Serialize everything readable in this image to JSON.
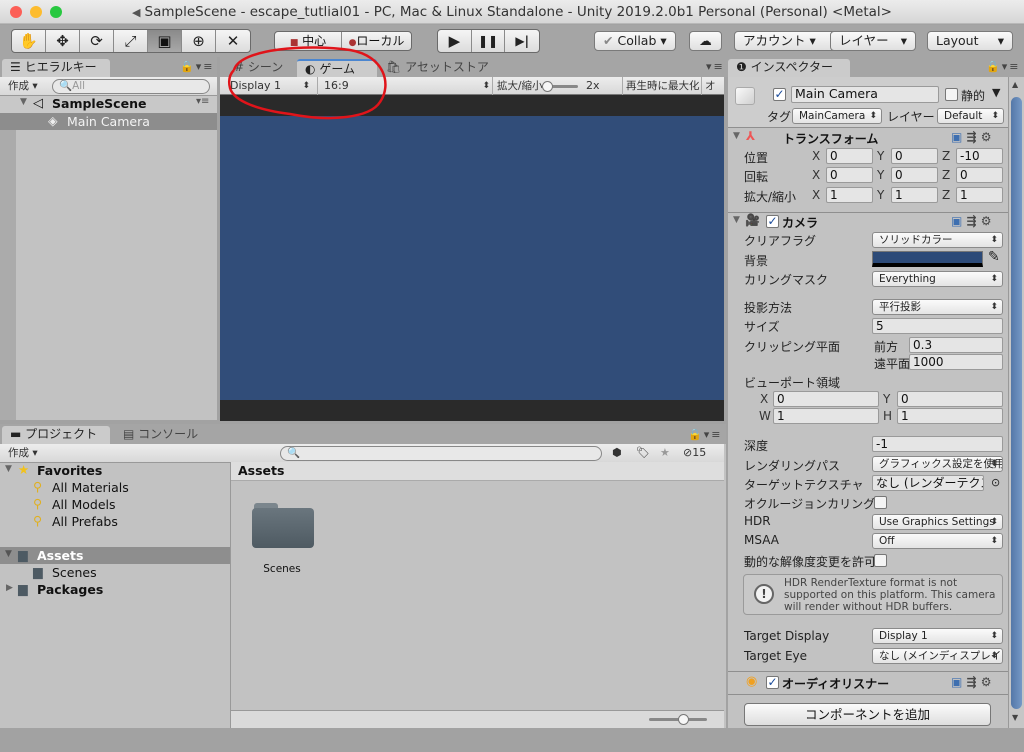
{
  "window": {
    "title": "SampleScene - escape_tutlial01 - PC, Mac & Linux Standalone - Unity 2019.2.0b1 Personal (Personal) <Metal>",
    "traffic_lights": {
      "close": "#fc5f57",
      "minimize": "#fdbc2e",
      "zoom": "#28c840"
    }
  },
  "toolbar": {
    "tools": [
      {
        "name": "hand-tool",
        "glyph": "✋"
      },
      {
        "name": "move-tool",
        "glyph": "✥"
      },
      {
        "name": "rotate-tool",
        "glyph": "⟳"
      },
      {
        "name": "scale-tool",
        "glyph": "⤢"
      },
      {
        "name": "rect-tool",
        "glyph": "▣"
      },
      {
        "name": "transform-tool",
        "glyph": "⊕"
      },
      {
        "name": "custom-tool",
        "glyph": "✕"
      }
    ],
    "pivot_label": "中心",
    "space_label": "ローカル",
    "play_glyph": "▶",
    "pause_glyph": "❚❚",
    "step_glyph": "▶|",
    "collab_label": "Collab",
    "account_label": "アカウント",
    "layers_label": "レイヤー",
    "layout_label": "Layout"
  },
  "hierarchy": {
    "tab_label": "ヒエラルキー",
    "create_label": "作成",
    "search_placeholder": "All",
    "scene_name": "SampleScene",
    "items": [
      "Main Camera"
    ]
  },
  "game_view": {
    "tabs": [
      "シーン",
      "ゲーム",
      "アセットストア"
    ],
    "active_tab": "ゲーム",
    "display_select": "Display 1",
    "aspect_select": "16:9",
    "scale_label": "拡大/縮小",
    "scale_value": "2x",
    "scale_slider_fraction": 0.1,
    "maximize_on_play_label": "再生時に最大化",
    "mute_label": "オー",
    "background_color": "#314d79",
    "letterbox_color": "#2a2a2a",
    "annotation_color": "#e0141a"
  },
  "project": {
    "tabs": [
      "プロジェクト",
      "コンソール"
    ],
    "create_label": "作成",
    "hidden_count": "15",
    "favorites_label": "Favorites",
    "favorites": [
      "All Materials",
      "All Models",
      "All Prefabs"
    ],
    "assets_label": "Assets",
    "assets_children": [
      "Scenes"
    ],
    "packages_label": "Packages",
    "breadcrumb": "Assets",
    "grid_items": [
      "Scenes"
    ],
    "zoom_slider_fraction": 0.6
  },
  "inspector": {
    "tab_label": "インスペクター",
    "object": {
      "active": true,
      "name": "Main Camera",
      "static_label": "静的",
      "static": false,
      "tag_label": "タグ",
      "tag_value": "MainCamera",
      "layer_label": "レイヤー",
      "layer_value": "Default"
    },
    "transform": {
      "title": "トランスフォーム",
      "rows": [
        {
          "label": "位置",
          "x": "0",
          "y": "0",
          "z": "-10"
        },
        {
          "label": "回転",
          "x": "0",
          "y": "0",
          "z": "0"
        },
        {
          "label": "拡大/縮小",
          "x": "1",
          "y": "1",
          "z": "1"
        }
      ]
    },
    "camera": {
      "title": "カメラ",
      "enabled": true,
      "clear_flags_label": "クリアフラグ",
      "clear_flags_value": "ソリッドカラー",
      "background_label": "背景",
      "background_color": "#2c4a78",
      "culling_mask_label": "カリングマスク",
      "culling_mask_value": "Everything",
      "projection_label": "投影方法",
      "projection_value": "平行投影",
      "size_label": "サイズ",
      "size_value": "5",
      "clipping_label": "クリッピング平面",
      "near_label": "前方",
      "near_value": "0.3",
      "far_label": "遠平面",
      "far_value": "1000",
      "viewport_label": "ビューポート領域",
      "viewport": {
        "x": "0",
        "y": "0",
        "w": "1",
        "h": "1"
      },
      "depth_label": "深度",
      "depth_value": "-1",
      "rendering_path_label": "レンダリングパス",
      "rendering_path_value": "グラフィックス設定を使用",
      "target_texture_label": "ターゲットテクスチャ",
      "target_texture_value": "なし (レンダーテクスチャ)",
      "occlusion_label": "オクルージョンカリング",
      "occlusion": false,
      "hdr_label": "HDR",
      "hdr_value": "Use Graphics Settings",
      "msaa_label": "MSAA",
      "msaa_value": "Off",
      "dynamic_res_label": "動的な解像度変更を許可",
      "dynamic_res": false,
      "warning": "HDR RenderTexture format is not supported on this platform. This camera will render without HDR buffers.",
      "target_display_label": "Target Display",
      "target_display_value": "Display 1",
      "target_eye_label": "Target Eye",
      "target_eye_value": "なし (メインディスプレイ)"
    },
    "audio_listener": {
      "title": "オーディオリスナー",
      "enabled": true
    },
    "add_component_label": "コンポーネントを追加"
  }
}
